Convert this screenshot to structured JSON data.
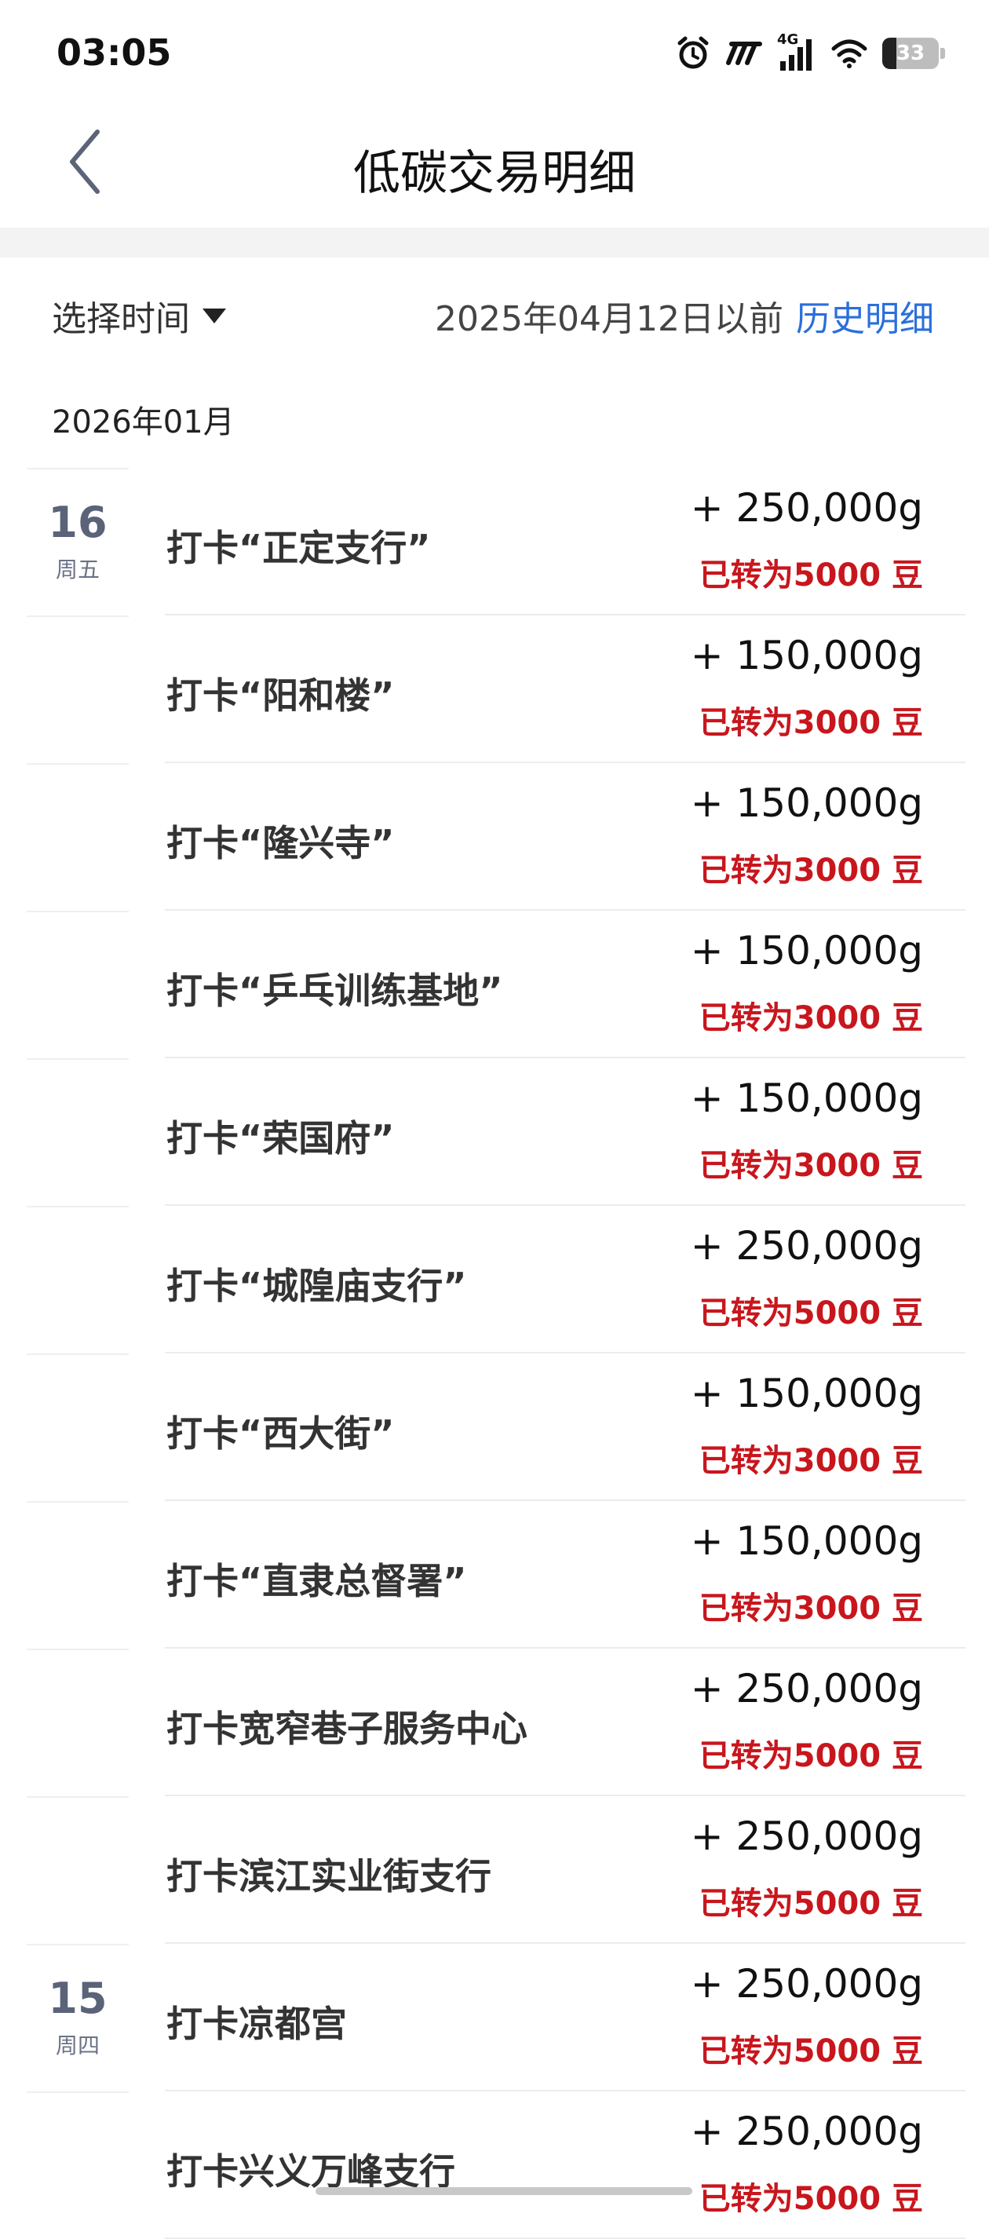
{
  "status_bar": {
    "time": "03:05",
    "battery": "33",
    "signal_label": "4G",
    "icons": [
      "alarm-icon",
      "nfc-icon",
      "cellular-signal-icon",
      "wifi-icon",
      "battery-icon"
    ]
  },
  "nav": {
    "title": "低碳交易明细",
    "back_icon": "chevron-left-icon"
  },
  "filter": {
    "time_select_label": "选择时间",
    "history_note": "2025年04月12日以前",
    "history_link": "历史明细"
  },
  "month": "2026年01月",
  "transactions": [
    {
      "day": "16",
      "weekday": "周五",
      "title": "打卡“正定支行”",
      "amount": "+ 250,000g",
      "converted": "已转为5000 豆"
    },
    {
      "day": "",
      "weekday": "",
      "title": "打卡“阳和楼”",
      "amount": "+ 150,000g",
      "converted": "已转为3000 豆"
    },
    {
      "day": "",
      "weekday": "",
      "title": "打卡“隆兴寺”",
      "amount": "+ 150,000g",
      "converted": "已转为3000 豆"
    },
    {
      "day": "",
      "weekday": "",
      "title": "打卡“乒乓训练基地”",
      "amount": "+ 150,000g",
      "converted": "已转为3000 豆"
    },
    {
      "day": "",
      "weekday": "",
      "title": "打卡“荣国府”",
      "amount": "+ 150,000g",
      "converted": "已转为3000 豆"
    },
    {
      "day": "",
      "weekday": "",
      "title": "打卡“城隍庙支行”",
      "amount": "+ 250,000g",
      "converted": "已转为5000 豆"
    },
    {
      "day": "",
      "weekday": "",
      "title": "打卡“西大街”",
      "amount": "+ 150,000g",
      "converted": "已转为3000 豆"
    },
    {
      "day": "",
      "weekday": "",
      "title": "打卡“直隶总督署”",
      "amount": "+ 150,000g",
      "converted": "已转为3000 豆"
    },
    {
      "day": "",
      "weekday": "",
      "title": "打卡宽窄巷子服务中心",
      "amount": "+ 250,000g",
      "converted": "已转为5000 豆"
    },
    {
      "day": "",
      "weekday": "",
      "title": "打卡滨江实业街支行",
      "amount": "+ 250,000g",
      "converted": "已转为5000 豆"
    },
    {
      "day": "15",
      "weekday": "周四",
      "title": "打卡凉都宫",
      "amount": "+ 250,000g",
      "converted": "已转为5000 豆"
    },
    {
      "day": "",
      "weekday": "",
      "title": "打卡兴义万峰支行",
      "amount": "+ 250,000g",
      "converted": "已转为5000 豆"
    }
  ]
}
